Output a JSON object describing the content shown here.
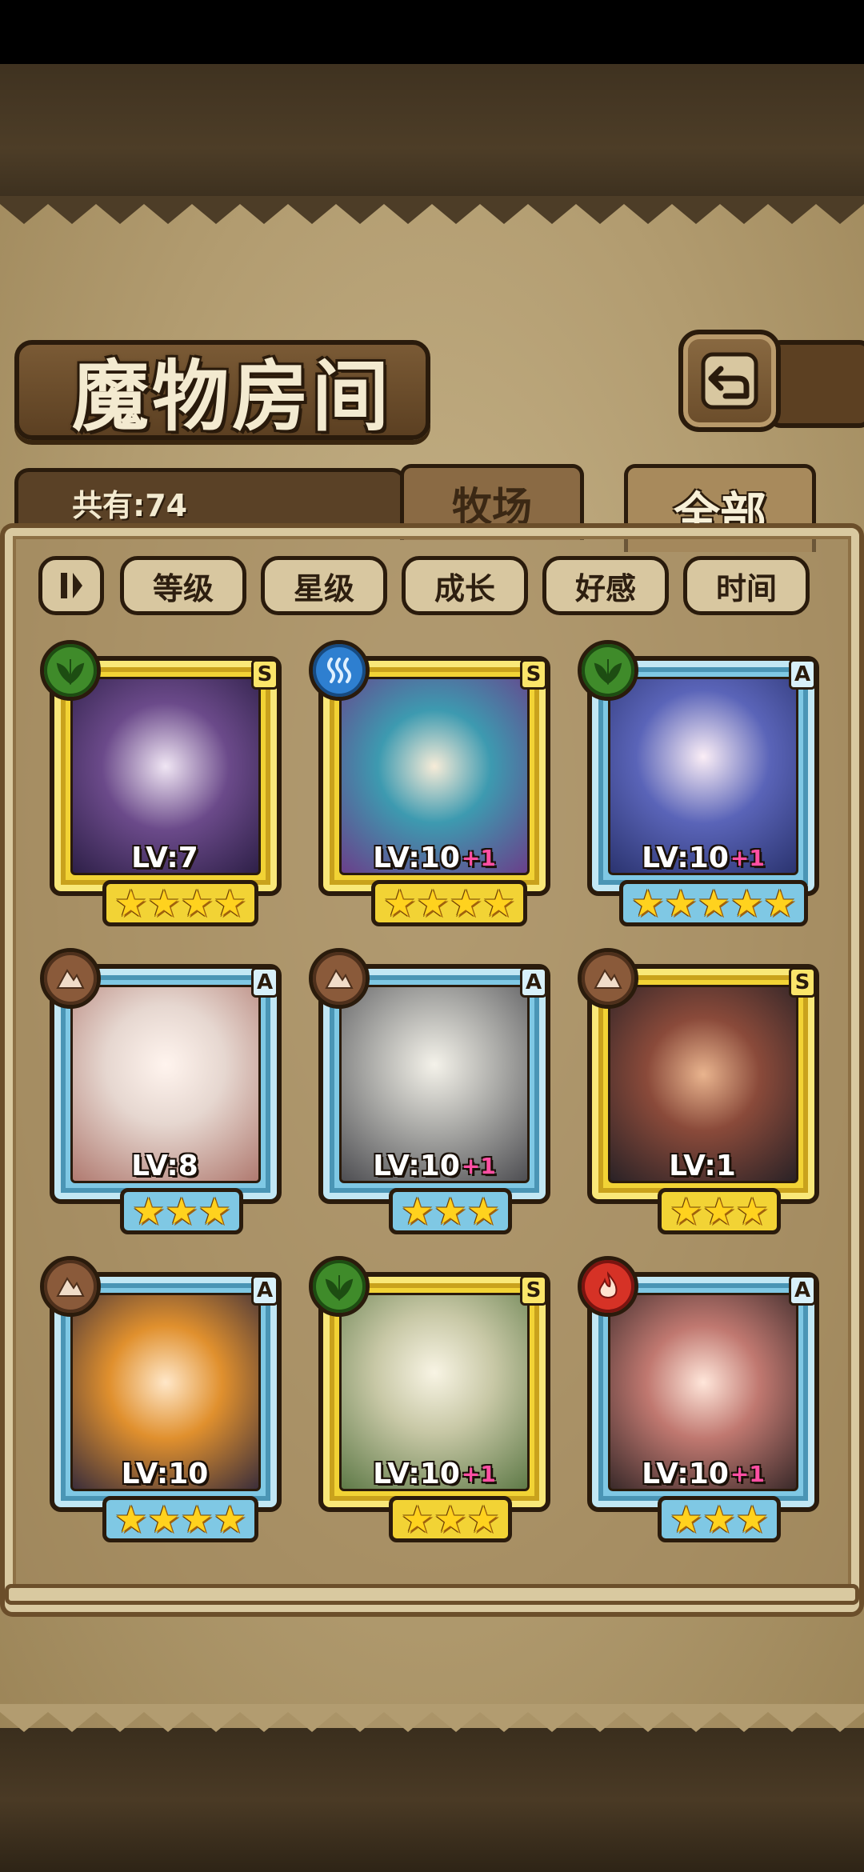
{
  "title": "魔物房间",
  "count_label": "共有:74",
  "tabs": [
    {
      "label": "牧场",
      "active": false
    },
    {
      "label": "全部",
      "active": true
    }
  ],
  "sort_buttons": [
    "等级",
    "星级",
    "成长",
    "好感",
    "时间"
  ],
  "colors": {
    "rank_s_frame": "#f2d335",
    "rank_a_frame": "#7fc8e4",
    "grass": "#3f8b2a",
    "water": "#2e7fd0",
    "earth": "#8a5a3a",
    "fire": "#d63226",
    "plus_level": "#ff4fa3",
    "star": "#ffd21e"
  },
  "monsters": [
    {
      "rank": "S",
      "element": "grass",
      "level": "LV:7",
      "plus": "",
      "stars": "★★★★",
      "star_count": 4
    },
    {
      "rank": "S",
      "element": "water",
      "level": "LV:10",
      "plus": "+1",
      "stars": "★★★★",
      "star_count": 4
    },
    {
      "rank": "A",
      "element": "grass",
      "level": "LV:10",
      "plus": "+1",
      "stars": "★★★★★",
      "star_count": 5
    },
    {
      "rank": "A",
      "element": "earth",
      "level": "LV:8",
      "plus": "",
      "stars": "★★★",
      "star_count": 3
    },
    {
      "rank": "A",
      "element": "earth",
      "level": "LV:10",
      "plus": "+1",
      "stars": "★★★",
      "star_count": 3
    },
    {
      "rank": "S",
      "element": "earth",
      "level": "LV:1",
      "plus": "",
      "stars": "★★★",
      "star_count": 3
    },
    {
      "rank": "A",
      "element": "earth",
      "level": "LV:10",
      "plus": "",
      "stars": "★★★★",
      "star_count": 4
    },
    {
      "rank": "S",
      "element": "grass",
      "level": "LV:10",
      "plus": "+1",
      "stars": "★★★",
      "star_count": 3
    },
    {
      "rank": "A",
      "element": "fire",
      "level": "LV:10",
      "plus": "+1",
      "stars": "★★★",
      "star_count": 3
    }
  ]
}
